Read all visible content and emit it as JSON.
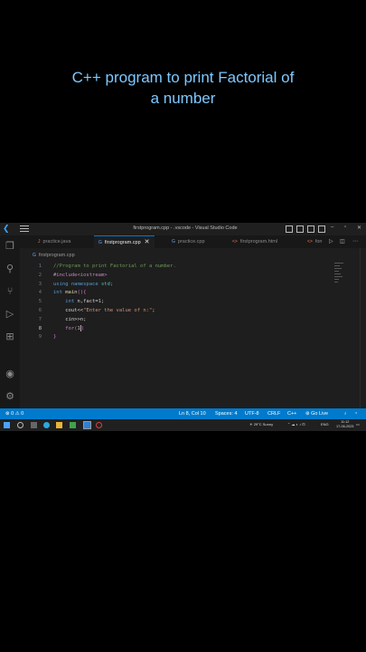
{
  "caption": {
    "line1": "C++ program to print Factorial of",
    "line2": "a number"
  },
  "window": {
    "title": "firstprogram.cpp - .vscode - Visual Studio Code"
  },
  "tabs": [
    {
      "label": "practice.java",
      "icon": "java-file-icon",
      "active": false
    },
    {
      "label": "firstprogram.cpp",
      "icon": "cpp-file-icon",
      "active": true
    },
    {
      "label": "practice.cpp",
      "icon": "cpp-file-icon",
      "active": false
    },
    {
      "label": "firstprogram.html",
      "icon": "html-file-icon",
      "active": false
    },
    {
      "label": "fon",
      "icon": "html-file-icon",
      "active": false
    }
  ],
  "breadcrumb": {
    "file": "firstprogram.cpp"
  },
  "editor": {
    "line_numbers": [
      "1",
      "2",
      "3",
      "4",
      "5",
      "6",
      "7",
      "8",
      "9"
    ],
    "current_line": 8,
    "code": {
      "l1": "//Program to print Factorial of a number.",
      "l2": "#include<iostream>",
      "l3_kw": "using namespace",
      "l3_rest": " std;",
      "l4_type": "int",
      "l4_fn": "main",
      "l4_rest": "(){",
      "l5_type": "int",
      "l5_rest": " n,fact=",
      "l5_num": "1",
      "l5_end": ";",
      "l6_a": "cout<<",
      "l6_str": "\"Enter the value of n:\"",
      "l6_end": ";",
      "l7": "cin>>n;",
      "l8_kw": "for",
      "l8_open": "(",
      "l8_num": "1",
      "l8_close": ")",
      "l9": "}"
    }
  },
  "statusbar": {
    "problems": "⊗ 0 ⚠ 0",
    "position": "Ln 8, Col 10",
    "spaces": "Spaces: 4",
    "encoding": "UTF-8",
    "eol": "CRLF",
    "language": "C++",
    "golive": "Go Live"
  },
  "taskbar": {
    "weather": "29°C Sunny",
    "lang": "ENG",
    "time": "11:12",
    "date": "17-06-2023"
  },
  "colors": {
    "accent": "#007acc",
    "caption": "#7ec8ff",
    "editor_bg": "#1e1e1e"
  }
}
